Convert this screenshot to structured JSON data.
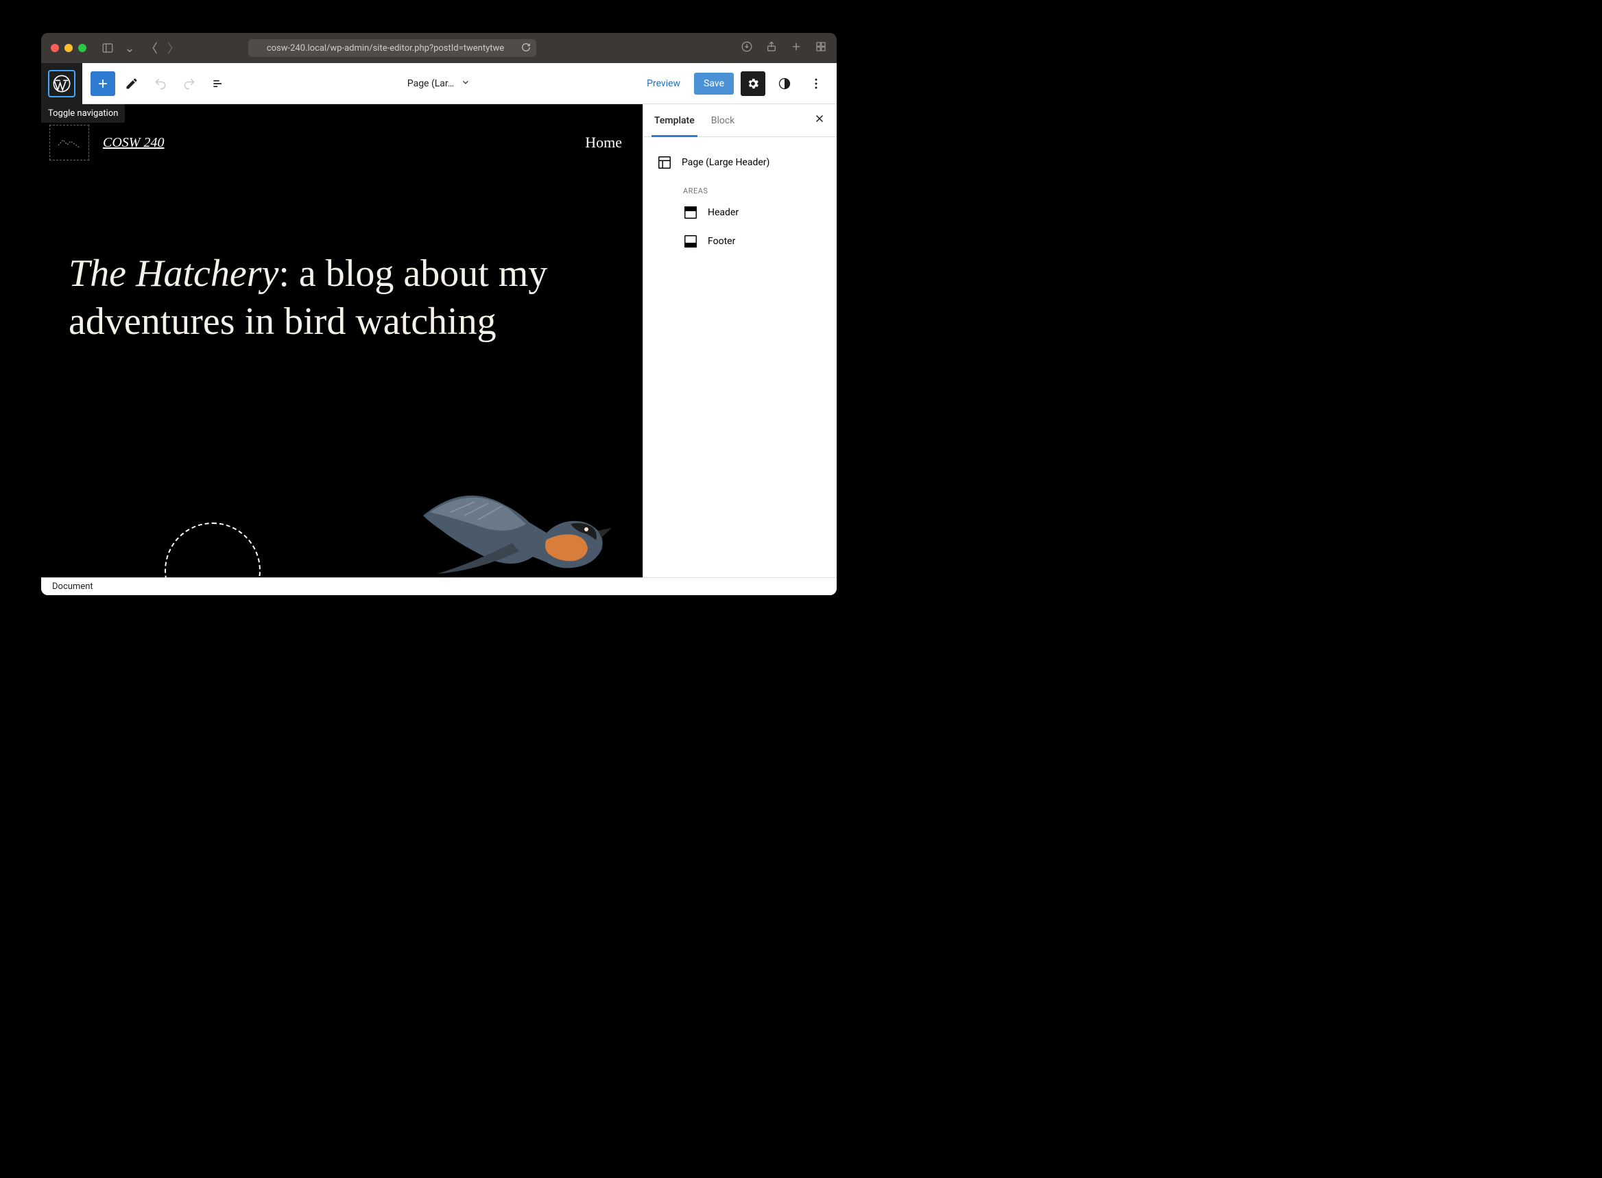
{
  "browser": {
    "url": "cosw-240.local/wp-admin/site-editor.php?postId=twentytwe"
  },
  "toolbar": {
    "tooltip": "Toggle navigation",
    "template_dropdown": "Page (Lar…",
    "preview": "Preview",
    "save": "Save"
  },
  "canvas": {
    "site_title": "COSW 240",
    "nav_item": "Home",
    "hero_italic": "The Hatchery",
    "hero_rest": ": a blog about my adventures in bird watching"
  },
  "sidebar": {
    "tabs": {
      "template": "Template",
      "block": "Block"
    },
    "template_name": "Page (Large Header)",
    "areas_heading": "AREAS",
    "areas": [
      {
        "label": "Header"
      },
      {
        "label": "Footer"
      }
    ]
  },
  "footer": {
    "breadcrumb": "Document"
  }
}
